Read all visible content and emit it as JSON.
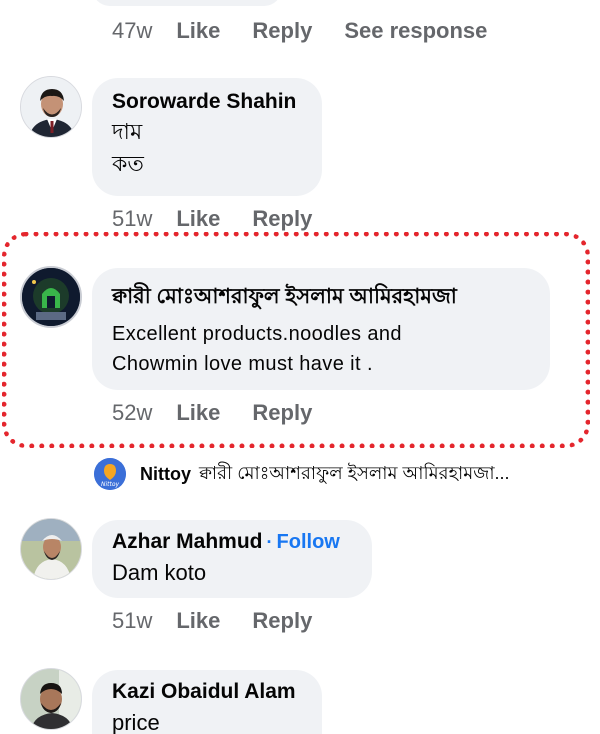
{
  "top_actions": {
    "time": "47w",
    "like": "Like",
    "reply": "Reply",
    "see_response": "See response"
  },
  "comments": [
    {
      "author": "Sorowarde Shahin",
      "lines": [
        "দাম",
        "কত"
      ],
      "time": "51w",
      "like": "Like",
      "reply": "Reply"
    },
    {
      "author": "ক্বারী মোঃআশরাফুল ইসলাম আমিরহামজা",
      "lines": [
        "Excellent products.noodles and",
        "Chowmin love must have it ."
      ],
      "time": "52w",
      "like": "Like",
      "reply": "Reply"
    },
    {
      "author": "Azhar Mahmud",
      "follow": "Follow",
      "lines": [
        "Dam koto"
      ],
      "time": "51w",
      "like": "Like",
      "reply": "Reply"
    },
    {
      "author": "Kazi Obaidul Alam",
      "lines": [
        "price"
      ]
    }
  ],
  "reply_preview": {
    "avatar_text": "Nittoy",
    "author": "Nittoy",
    "snippet": "ক্বারী মোঃআশরাফুল ইসলাম আমিরহামজা..."
  },
  "colors": {
    "highlight": "#e4262d",
    "link": "#1877f2",
    "bubble": "#f0f2f5",
    "meta": "#65676b"
  }
}
